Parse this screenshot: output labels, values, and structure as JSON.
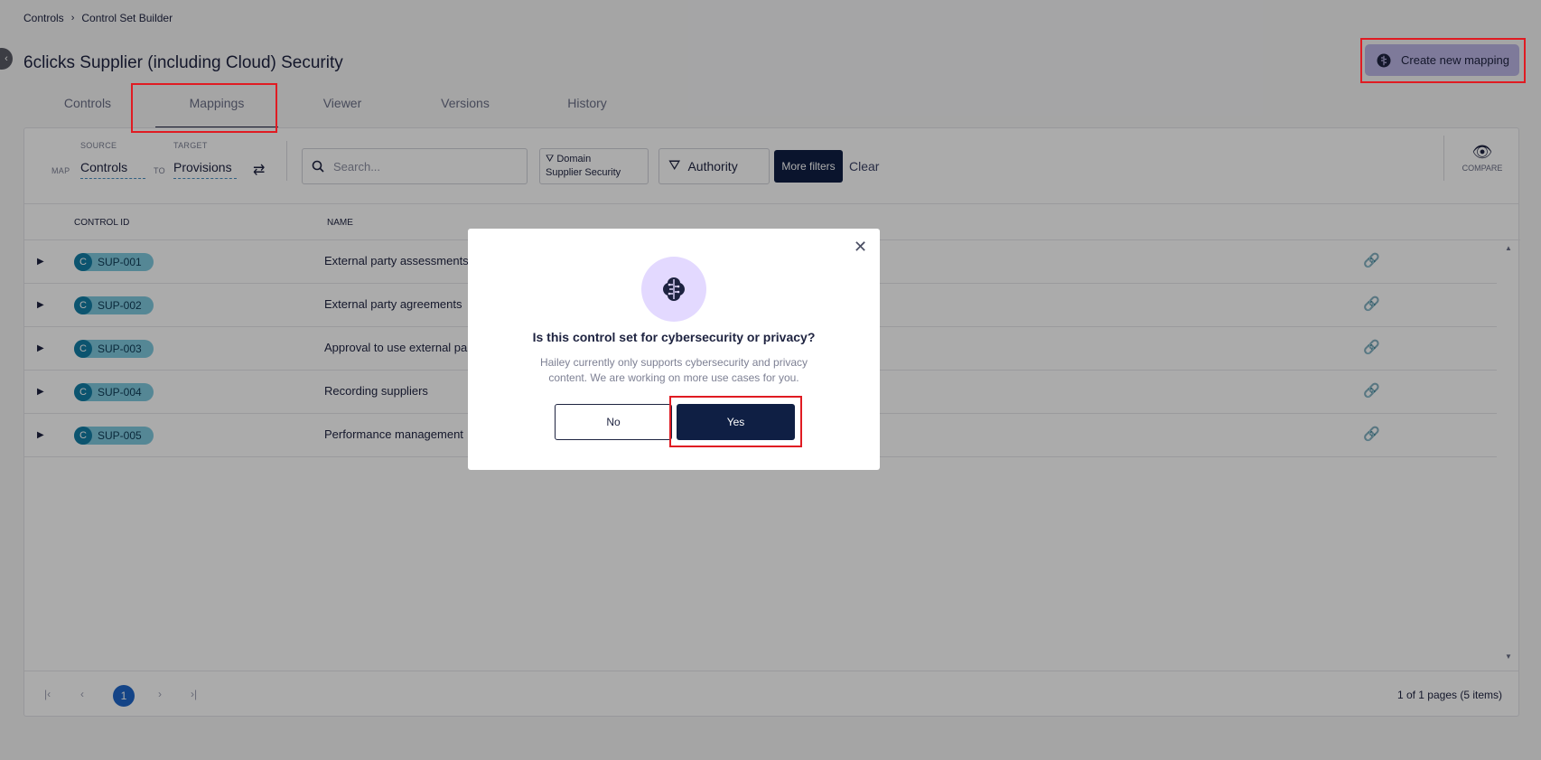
{
  "breadcrumb": {
    "root": "Controls",
    "separator": "›",
    "current": "Control Set Builder"
  },
  "collapse_glyph": "‹",
  "page": {
    "title": "6clicks Supplier (including Cloud) Security",
    "create_button": "Create new mapping"
  },
  "tabs": [
    {
      "label": "Controls",
      "active": false
    },
    {
      "label": "Mappings",
      "active": true
    },
    {
      "label": "Viewer",
      "active": false
    },
    {
      "label": "Versions",
      "active": false
    },
    {
      "label": "History",
      "active": false
    }
  ],
  "toolbar": {
    "map_label": "MAP",
    "source_label": "SOURCE",
    "source_value": "Controls",
    "to_label": "TO",
    "target_label": "TARGET",
    "target_value": "Provisions",
    "search_placeholder": "Search...",
    "domain_filter_label": "Domain",
    "domain_filter_value": "Supplier Security",
    "authority_filter": "Authority",
    "more_filters": "More filters",
    "clear": "Clear",
    "compare": "COMPARE"
  },
  "table": {
    "columns": [
      "CONTROL ID",
      "NAME"
    ],
    "badge_letter": "C",
    "rows": [
      {
        "id": "SUP-001",
        "name": "External party assessments"
      },
      {
        "id": "SUP-002",
        "name": "External party agreements"
      },
      {
        "id": "SUP-003",
        "name": "Approval to use external par"
      },
      {
        "id": "SUP-004",
        "name": "Recording suppliers"
      },
      {
        "id": "SUP-005",
        "name": "Performance management"
      }
    ]
  },
  "pagination": {
    "current_page": "1",
    "summary": "1 of 1 pages (5 items)"
  },
  "modal": {
    "question": "Is this control set for cybersecurity or privacy?",
    "description": "Hailey currently only supports cybersecurity and privacy content. We are working on more use cases for you.",
    "no_label": "No",
    "yes_label": "Yes"
  },
  "colors": {
    "primary": "#0f1f44",
    "accent": "#bdb6e6",
    "highlight": "#e01b22",
    "badge": "#127ea6",
    "page_active": "#1f66c9"
  }
}
